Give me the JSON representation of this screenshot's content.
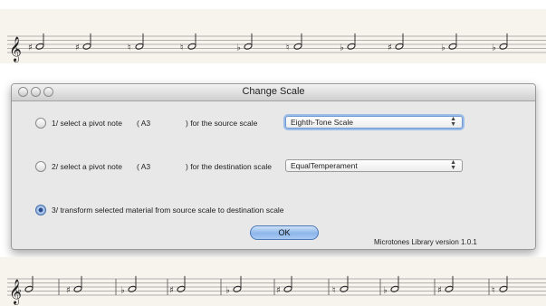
{
  "window": {
    "title": "Change Scale"
  },
  "options": [
    {
      "prefix": "1/ select a pivot note",
      "pivot_note": "( A3",
      "suffix": ") for the source scale",
      "selected": false,
      "select_value": "Eighth-Tone Scale"
    },
    {
      "prefix": "2/ select a pivot note",
      "pivot_note": "( A3",
      "suffix": ") for the destination scale",
      "selected": false,
      "select_value": "EqualTemperament"
    },
    {
      "label": "3/ transform selected material from source scale to destination scale",
      "selected": true
    }
  ],
  "ok_button": {
    "label": "OK"
  },
  "footer": {
    "version_text": "Microtones Library version 1.0.1"
  },
  "icons": {
    "close": "close-circle-icon",
    "minimize": "minimize-circle-icon",
    "zoom": "zoom-circle-icon",
    "select_arrows": "up-down-arrows-icon",
    "treble_clef": "treble-clef-icon"
  },
  "colors": {
    "window_bg": "#e8e8e8",
    "accent_blue": "#8db6ea",
    "staff_paper": "#f7f4ed"
  }
}
